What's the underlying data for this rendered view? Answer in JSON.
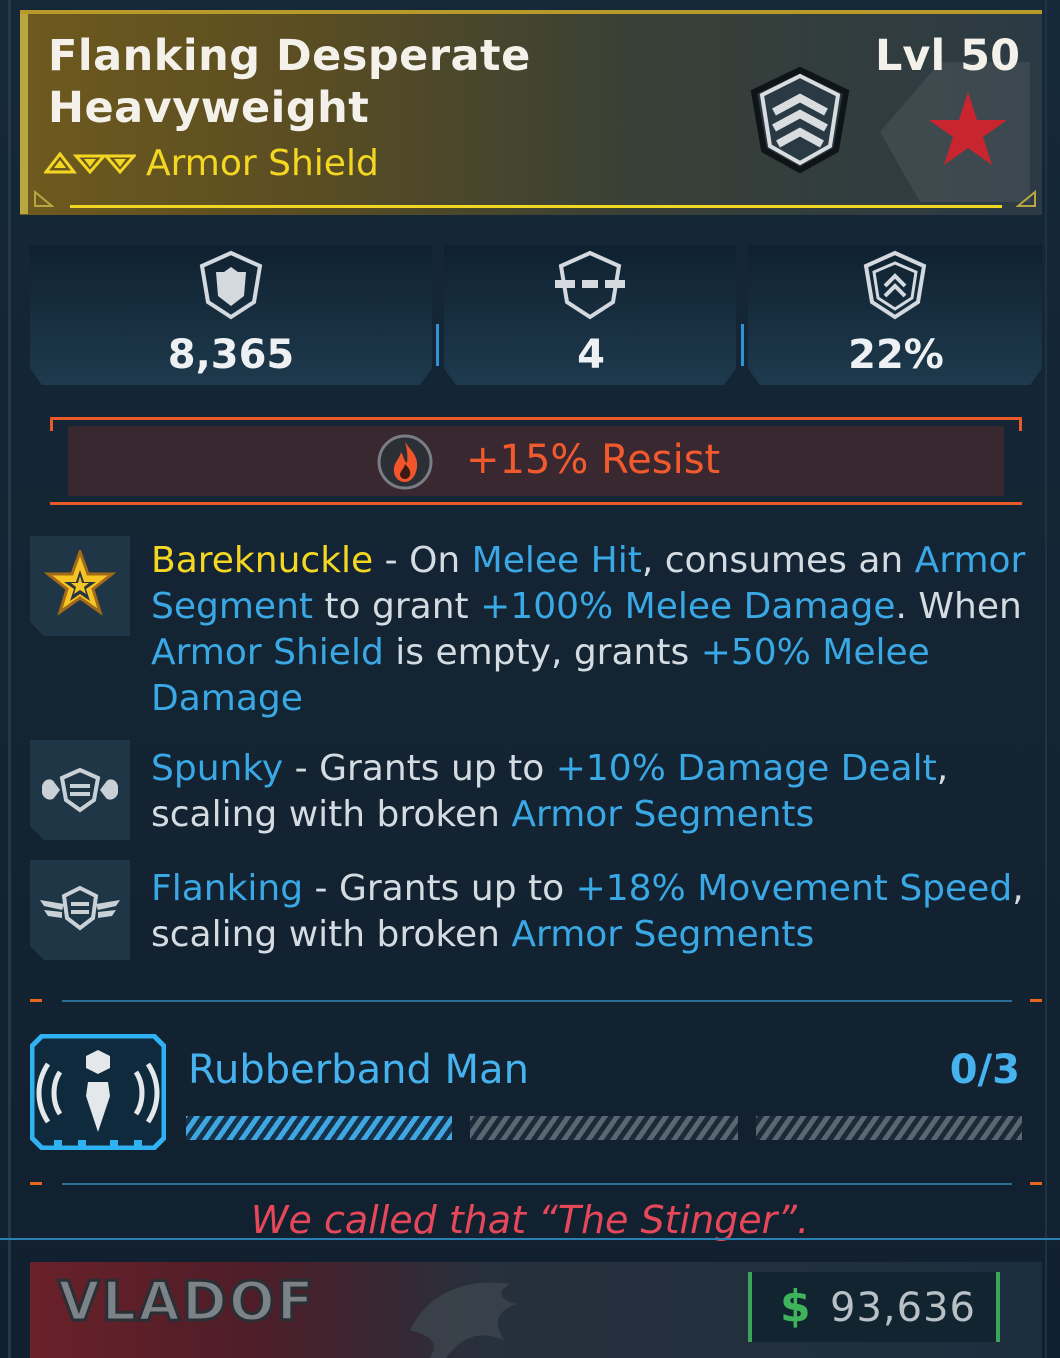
{
  "item": {
    "name_line1": "Flanking Desperate",
    "name_line2": "Heavyweight",
    "level": "Lvl 50",
    "type": "Armor Shield",
    "rarity_color": "#f4d722"
  },
  "stats": [
    {
      "icon": "shield-capacity-icon",
      "value": "8,365"
    },
    {
      "icon": "armor-segments-icon",
      "value": "4"
    },
    {
      "icon": "recharge-icon",
      "value": "22%"
    }
  ],
  "element": {
    "icon": "fire-icon",
    "text": "+15% Resist",
    "color": "#f25a2e"
  },
  "perks": [
    {
      "icon": "star-badge-icon",
      "name": "Bareknuckle",
      "parts": [
        " - On ",
        "Melee Hit",
        ", consumes an ",
        "Armor Segment",
        " to grant ",
        "+100% Melee Damage",
        ". When ",
        "Armor Shield",
        " is empty, grants ",
        "+50% Melee Damage"
      ]
    },
    {
      "icon": "flexing-arms-shield-icon",
      "name": "Spunky",
      "parts": [
        " - Grants up to ",
        "+10% Damage Dealt",
        ",",
        "scaling with broken ",
        "Armor Segments"
      ]
    },
    {
      "icon": "winged-shield-icon",
      "name": "Flanking",
      "parts": [
        " - Grants up to ",
        "+18% Movement Speed",
        ",",
        "scaling with broken ",
        "Armor Segments"
      ]
    }
  ],
  "ability": {
    "icon": "rubberband-radiating-icon",
    "name": "Rubberband Man",
    "count": "0/3",
    "progress_segments_filled": 1,
    "progress_segments_total": 3
  },
  "flavor": "We called that “The Stinger”.",
  "manufacturer": {
    "name": "VLADOF"
  },
  "price": {
    "symbol": "$",
    "value": "93,636"
  }
}
